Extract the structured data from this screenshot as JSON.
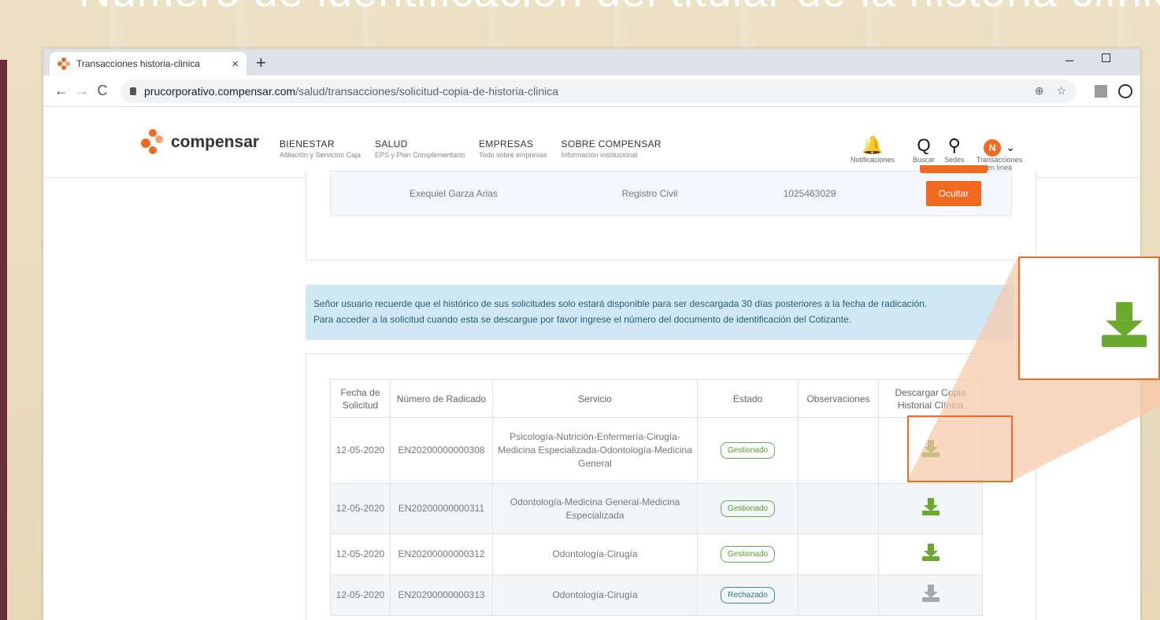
{
  "slide": {
    "title": "Número de identificación del titular de la historia clínica"
  },
  "browser": {
    "tab_title": "Transacciones historia-clinica",
    "tab_close": "×",
    "new_tab": "+",
    "minimize": "–",
    "url_host": "prucorporativo.compensar.com",
    "url_path": "/salud/transacciones/solicitud-copia-de-historia-clinica",
    "back": "←",
    "forward": "→",
    "reload": "C",
    "zoom_icon": "⊕",
    "star_icon": "☆"
  },
  "header": {
    "logo": "compensar",
    "menu": [
      {
        "title": "BIENESTAR",
        "sub": "Afiliación y Servicios Caja"
      },
      {
        "title": "SALUD",
        "sub": "EPS y Plan Complementario"
      },
      {
        "title": "EMPRESAS",
        "sub": "Todo sobre empresas"
      },
      {
        "title": "SOBRE COMPENSAR",
        "sub": "Información institucional"
      }
    ],
    "icons": [
      {
        "glyph": "🔔",
        "label": "Notificaciones"
      },
      {
        "glyph": "Q",
        "label": "Buscar"
      },
      {
        "glyph": "⚲",
        "label": "Sedes"
      }
    ],
    "avatar_letter": "N",
    "avatar_label": "Transacciones en línea",
    "avatar_caret": "⌄"
  },
  "beneficiary": {
    "name": "Exequiel Garza Arias",
    "doc_type": "Registro Civil",
    "doc_number": "1025463029",
    "button": "Ocultar"
  },
  "notice": {
    "line1": "Señor usuario recuerde que el histórico de sus solicitudes solo estará disponible para ser descargada 30 días posteriores a la fecha de radicación.",
    "line2": "Para acceder a la solicitud cuando esta se descargue por favor ingrese el número del documento de identificación del Cotizante."
  },
  "requests": {
    "headers": [
      "Fecha de Solicitud",
      "Número de Radicado",
      "Servicio",
      "Estado",
      "Observaciones",
      "Descargar Copia Historial Clínica"
    ],
    "rows": [
      {
        "fecha": "12-05-2020",
        "radicado": "EN20200000000308",
        "servicio": "Psicología-Nutrición-Enfermería-Cirugía-Medicina Especializada-Odontología-Medicina General",
        "estado": "Gestionado",
        "observaciones": "",
        "descarga": "green"
      },
      {
        "fecha": "12-05-2020",
        "radicado": "EN20200000000311",
        "servicio": "Odontología-Medicina General-Medicina Especializada",
        "estado": "Gestionado",
        "observaciones": "",
        "descarga": "green"
      },
      {
        "fecha": "12-05-2020",
        "radicado": "EN20200000000312",
        "servicio": "Odontología-Cirugía",
        "estado": "Gestionado",
        "observaciones": "",
        "descarga": "green"
      },
      {
        "fecha": "12-05-2020",
        "radicado": "EN20200000000313",
        "servicio": "Odontología-Cirugía",
        "estado": "Rechazado",
        "observaciones": "",
        "descarga": "gray"
      }
    ]
  },
  "colors": {
    "brand_orange": "#f26a21",
    "download_green": "#6aa82e",
    "download_disabled": "#a8a8a8",
    "notice_bg": "#cfe8f3"
  }
}
